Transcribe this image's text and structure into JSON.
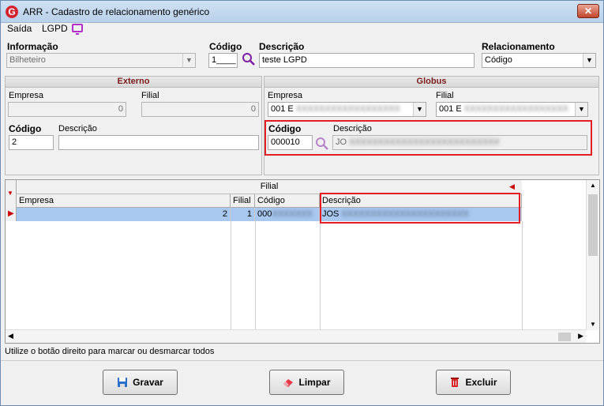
{
  "window": {
    "title": "ARR - Cadastro de relacionamento genérico",
    "close_label": "✕"
  },
  "menu": {
    "saida": "Saída",
    "lgpd": "LGPD"
  },
  "top": {
    "informacao_label": "Informação",
    "informacao_value": "Bilheteiro",
    "codigo_label": "Código",
    "codigo_value": "1____",
    "descricao_label": "Descrição",
    "descricao_value": "teste LGPD",
    "relacionamento_label": "Relacionamento",
    "relacionamento_value": "Código"
  },
  "externo": {
    "header": "Externo",
    "empresa_label": "Empresa",
    "empresa_value": "0",
    "filial_label": "Filial",
    "filial_value": "0",
    "codigo_label": "Código",
    "codigo_value": "2",
    "descricao_label": "Descrição",
    "descricao_value": ""
  },
  "globus": {
    "header": "Globus",
    "empresa_label": "Empresa",
    "empresa_value": "001 E",
    "filial_label": "Filial",
    "filial_value": "001 E",
    "codigo_label": "Código",
    "codigo_value": "000010",
    "descricao_label": "Descrição",
    "descricao_value": "JO"
  },
  "grid": {
    "band_title": "Filial",
    "columns": [
      "Empresa",
      "Filial",
      "Código",
      "Descrição"
    ],
    "rows": [
      {
        "empresa": "2",
        "filial": "1",
        "codigo": "000",
        "descricao": "JOS"
      }
    ]
  },
  "status_text": "Utilize o botão direito para marcar ou desmarcar todos",
  "buttons": {
    "gravar": "Gravar",
    "limpar": "Limpar",
    "excluir": "Excluir"
  },
  "colors": {
    "highlight": "#e31e24",
    "selected_row": "#a8c8f0",
    "panel_header_text": "#7a1a1a"
  }
}
